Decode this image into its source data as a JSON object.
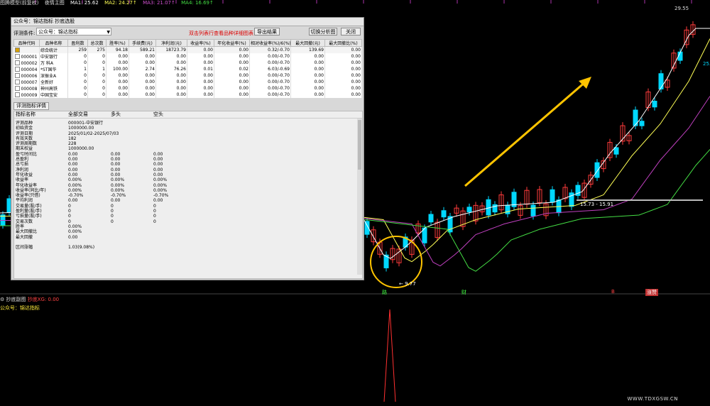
{
  "topbar": {
    "title": "图腾模型(前复权)",
    "indicator": "夜情主图",
    "ma1": "MA1: 25.62",
    "ma2": "MA2: 24.27↑",
    "ma3": "MA3: 21.07↑",
    "ma4": "MA4: 16.69↑"
  },
  "colors": {
    "up": "#ff3b3b",
    "down": "#00d8ff",
    "ma1": "#ffffff",
    "ma2": "#ffff55",
    "ma3": "#c040c0",
    "ma4": "#44dd44"
  },
  "chart_data": {
    "type": "candlestick",
    "price_high_label": "29.55",
    "price_right_label": "25.3",
    "range_label": "15.73 - 15.91",
    "low_label": "← 9.77",
    "markers": [
      "路",
      "财",
      "B",
      "涨赞"
    ]
  },
  "subchart": {
    "title": "抄底副图",
    "xg": "抄底XG: 0.00",
    "public_label": "公众号：锦达指标"
  },
  "watermark": "WWW.TDXGSW.CN",
  "dialog": {
    "title": "公众号：锦达指标 抄底选股",
    "cond_label": "评测条件:",
    "cond_value": "公众号：锦达指标",
    "hint": "双击列表行查看品种详细图表",
    "btn_export": "导出结果",
    "btn_switch": "切换分析图",
    "btn_close": "关闭",
    "columns": [
      "品种代码",
      "品种名称",
      "盈利数",
      "总次数",
      "胜率(%)",
      "手续费(元)",
      "净利润(元)",
      "收益率(%)",
      "年化收益率(%)",
      "相对收益率(%)/6(%)",
      "最大回撤(元)",
      "最大回撤比(%)"
    ],
    "rows": [
      {
        "checked": true,
        "code": "",
        "name": "综合统计",
        "c3": "259",
        "c4": "275",
        "c5": "94.18",
        "c6": "589.21",
        "c7": "18723.79",
        "c8": "0.00",
        "c9": "0.00",
        "c10": "0.32/-0.70",
        "c11": "139.69",
        "c12": "0.00"
      },
      {
        "checked": false,
        "code": "000001",
        "name": "中安银行",
        "c3": "0",
        "c4": "0",
        "c5": "0.00",
        "c6": "0.00",
        "c7": "0.00",
        "c8": "0.00",
        "c9": "0.00",
        "c10": "0.00/-0.70",
        "c11": "0.00",
        "c12": "0.00"
      },
      {
        "checked": false,
        "code": "000002",
        "name": "万 科A",
        "c3": "0",
        "c4": "0",
        "c5": "0.00",
        "c6": "0.00",
        "c7": "0.00",
        "c8": "0.00",
        "c9": "0.00",
        "c10": "0.00/-0.70",
        "c11": "0.00",
        "c12": "0.00"
      },
      {
        "checked": false,
        "code": "000004",
        "name": "*ST国华",
        "c3": "1",
        "c4": "1",
        "c5": "100.00",
        "c6": "2.74",
        "c7": "76.26",
        "c8": "0.01",
        "c9": "0.02",
        "c10": "6.03/-0.69",
        "c11": "0.00",
        "c12": "0.00"
      },
      {
        "checked": false,
        "code": "000006",
        "name": "深振业A",
        "c3": "0",
        "c4": "0",
        "c5": "0.00",
        "c6": "0.00",
        "c7": "0.00",
        "c8": "0.00",
        "c9": "0.00",
        "c10": "0.00/-0.70",
        "c11": "0.00",
        "c12": "0.00"
      },
      {
        "checked": false,
        "code": "000007",
        "name": "全新好",
        "c3": "0",
        "c4": "0",
        "c5": "0.00",
        "c6": "0.00",
        "c7": "0.00",
        "c8": "0.00",
        "c9": "0.00",
        "c10": "0.00/-0.70",
        "c11": "0.00",
        "c12": "0.00"
      },
      {
        "checked": false,
        "code": "000008",
        "name": "神州高铁",
        "c3": "0",
        "c4": "0",
        "c5": "0.00",
        "c6": "0.00",
        "c7": "0.00",
        "c8": "0.00",
        "c9": "0.00",
        "c10": "0.00/-0.70",
        "c11": "0.00",
        "c12": "0.00"
      },
      {
        "checked": false,
        "code": "000009",
        "name": "中国宝安",
        "c3": "0",
        "c4": "0",
        "c5": "0.00",
        "c6": "0.00",
        "c7": "0.00",
        "c8": "0.00",
        "c9": "0.00",
        "c10": "0.00/-0.70",
        "c11": "0.00",
        "c12": "0.00"
      }
    ],
    "detail_tab": "评测指标详情",
    "detail_headers": [
      "指标名称",
      "全部交易",
      "多头",
      "空头"
    ],
    "detail_rows": [
      [
        "评测品种",
        "000001-中安银行",
        "",
        ""
      ],
      [
        "初始资金",
        "1000000.00",
        "",
        ""
      ],
      [
        "评测日期",
        "2025/01/02-2025/07/03",
        "",
        ""
      ],
      [
        "有效天数",
        "182",
        "",
        ""
      ],
      [
        "评测周期数",
        "228",
        "",
        ""
      ],
      [
        "期末权益",
        "1000000.00",
        "",
        ""
      ],
      [
        "盈亏时间比",
        "0.00",
        "0.00",
        "0.00"
      ],
      [
        "总盈利",
        "0.00",
        "0.00",
        "0.00"
      ],
      [
        "总亏损",
        "0.00",
        "0.00",
        "0.00"
      ],
      [
        "净利润",
        "0.00",
        "0.00",
        "0.00"
      ],
      [
        "年化收益",
        "0.00",
        "0.00",
        "0.00"
      ],
      [
        "收益率",
        "0.00%",
        "0.00%",
        "0.00%"
      ],
      [
        "年化收益率",
        "0.00%",
        "0.00%",
        "0.00%"
      ],
      [
        "收益率(同比/年)",
        "0.00%",
        "0.00%",
        "0.00%"
      ],
      [
        "收益率(只借)",
        "-0.70%",
        "-0.70%",
        "-0.70%"
      ],
      [
        "平均利润",
        "0.00",
        "0.00",
        "0.00"
      ],
      [
        "交易量(股/手)",
        "0",
        "0",
        "0"
      ],
      [
        "盈利量(股/手)",
        "0",
        "0",
        "0"
      ],
      [
        "亏损量(股/手)",
        "0",
        "0",
        "0"
      ],
      [
        "交易次数",
        "0",
        "0",
        "0"
      ],
      [
        "胜率",
        "0.00%",
        "",
        ""
      ],
      [
        "最大回撤比",
        "0.00%",
        "",
        ""
      ],
      [
        "最大回撤",
        "0.00",
        "",
        ""
      ],
      [
        "",
        "",
        " ",
        ""
      ],
      [
        "区间涨幅",
        "1.03(9.08%)",
        "",
        ""
      ]
    ]
  }
}
